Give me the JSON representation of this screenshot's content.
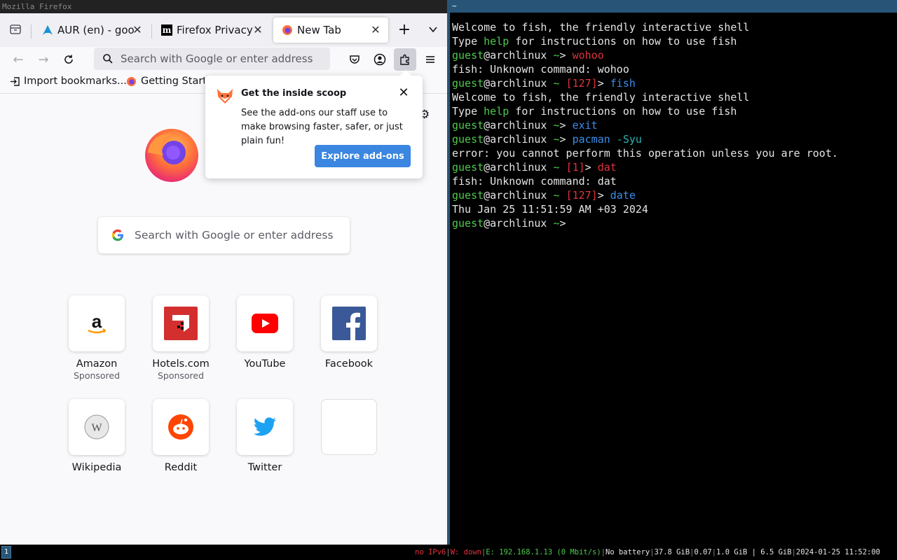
{
  "firefox": {
    "window_title": "Mozilla Firefox",
    "tabs": [
      {
        "label": "AUR (en) - google",
        "icon": "arch-icon"
      },
      {
        "label": "Firefox Privacy Notice",
        "icon": "mozilla-m-icon"
      },
      {
        "label": "New Tab",
        "icon": "firefox-icon"
      }
    ],
    "url_placeholder": "Search with Google or enter address",
    "bookmarks": [
      {
        "label": "Import bookmarks..."
      },
      {
        "label": "Getting Started"
      }
    ],
    "search_placeholder": "Search with Google or enter address",
    "top_sites": [
      {
        "name": "Amazon",
        "sponsored": "Sponsored"
      },
      {
        "name": "Hotels.com",
        "sponsored": "Sponsored"
      },
      {
        "name": "YouTube",
        "sponsored": ""
      },
      {
        "name": "Facebook",
        "sponsored": ""
      },
      {
        "name": "Wikipedia",
        "sponsored": ""
      },
      {
        "name": "Reddit",
        "sponsored": ""
      },
      {
        "name": "Twitter",
        "sponsored": ""
      }
    ],
    "popup": {
      "title": "Get the inside scoop",
      "body": "See the add-ons our staff use to make browsing faster, safer, or just plain fun!",
      "button": "Explore add-ons"
    }
  },
  "terminal": {
    "window_title": "~",
    "lines": {
      "welcome1": "Welcome to fish, the friendly interactive shell",
      "type": "Type ",
      "help": "help",
      "instr": " for instructions on how to use fish",
      "user": "guest",
      "host": "@archlinux",
      "tilde": " ~",
      "prompt": "> ",
      "cmd1": "wohoo",
      "err1": "fish: Unknown command: wohoo",
      "code127": "[127]",
      "cmd2": "fish",
      "welcome2": "Welcome to fish, the friendly interactive shell",
      "cmd3": "exit",
      "cmd4a": "pacman",
      "cmd4b": " -Syu",
      "err2": "error: you cannot perform this operation unless you are root.",
      "code1": "[1]",
      "cmd5": "dat",
      "err3": "fish: Unknown command: dat",
      "code127b": "[127]",
      "cmd6": "date",
      "out6": "Thu Jan 25 11:51:59 AM +03 2024"
    }
  },
  "statusbar": {
    "workspace": "1",
    "ipv6": "no IPv6",
    "wifi": "W: down",
    "eth": "E: 192.168.1.13 (0 Mbit/s)",
    "battery": "No battery",
    "disk": "37.8 GiB",
    "load": "0.07",
    "mem": "1.0 GiB | 6.5 GiB",
    "datetime": "2024-01-25 11:52:00"
  }
}
